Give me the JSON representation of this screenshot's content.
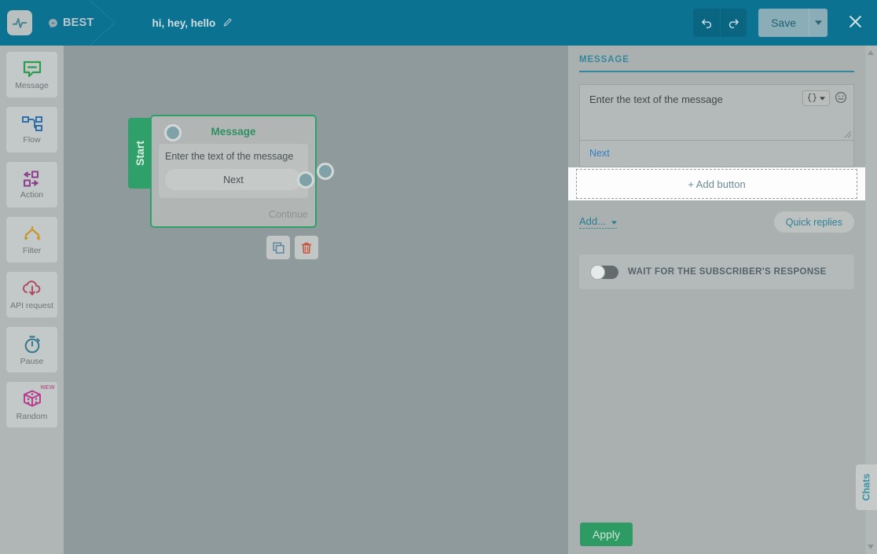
{
  "header": {
    "logo_icon": "activity-pulse-icon",
    "bot_name": "BEST",
    "bot_icon": "messenger-icon",
    "flow_name": "hi, hey, hello",
    "edit_icon": "pencil-icon",
    "undo_icon": "undo-arrow-icon",
    "redo_icon": "redo-arrow-icon",
    "save_label": "Save",
    "save_caret_icon": "chevron-down-icon",
    "close_icon": "close-x-icon"
  },
  "sidebar": {
    "items": [
      {
        "label": "Message",
        "icon": "speech-bubble-icon",
        "badge": ""
      },
      {
        "label": "Flow",
        "icon": "flow-nodes-icon",
        "badge": ""
      },
      {
        "label": "Action",
        "icon": "action-arrows-icon",
        "badge": ""
      },
      {
        "label": "Filter",
        "icon": "filter-split-icon",
        "badge": ""
      },
      {
        "label": "API request",
        "icon": "cloud-upload-icon",
        "badge": ""
      },
      {
        "label": "Pause",
        "icon": "stopwatch-icon",
        "badge": ""
      },
      {
        "label": "Random",
        "icon": "dice-icon",
        "badge": "NEW"
      }
    ]
  },
  "canvas": {
    "node": {
      "start_label": "Start",
      "title": "Message",
      "text": "Enter the text of the message",
      "button_label": "Next",
      "continue_label": "Continue"
    },
    "tools": {
      "copy_icon": "copy-icon",
      "delete_icon": "trash-icon"
    }
  },
  "panel": {
    "section_title": "MESSAGE",
    "message_text": "Enter the text of the message",
    "message_placeholder": "Enter the text of the message",
    "token_button_label": "{}",
    "token_caret_icon": "chevron-down-icon",
    "emoji_icon": "smiley-icon",
    "next_label": "Next",
    "add_button_label": "+ Add button",
    "add_more_label": "Add...",
    "add_more_caret_icon": "chevron-down-icon",
    "quick_replies_label": "Quick replies",
    "wait_toggle_label": "WAIT FOR THE SUBSCRIBER'S RESPONSE",
    "wait_toggle_state": "off",
    "apply_label": "Apply"
  },
  "right_rail": {
    "chats_label": "Chats",
    "scroll_up_icon": "triangle-up-icon",
    "scroll_down_icon": "triangle-down-icon"
  },
  "colors": {
    "header_teal": "#0c7291",
    "accent_teal": "#34889c",
    "node_green": "#2fa06a",
    "apply_green": "#2f9b64",
    "link_blue": "#2f7fc4",
    "canvas_gray": "#8e9a9b"
  }
}
